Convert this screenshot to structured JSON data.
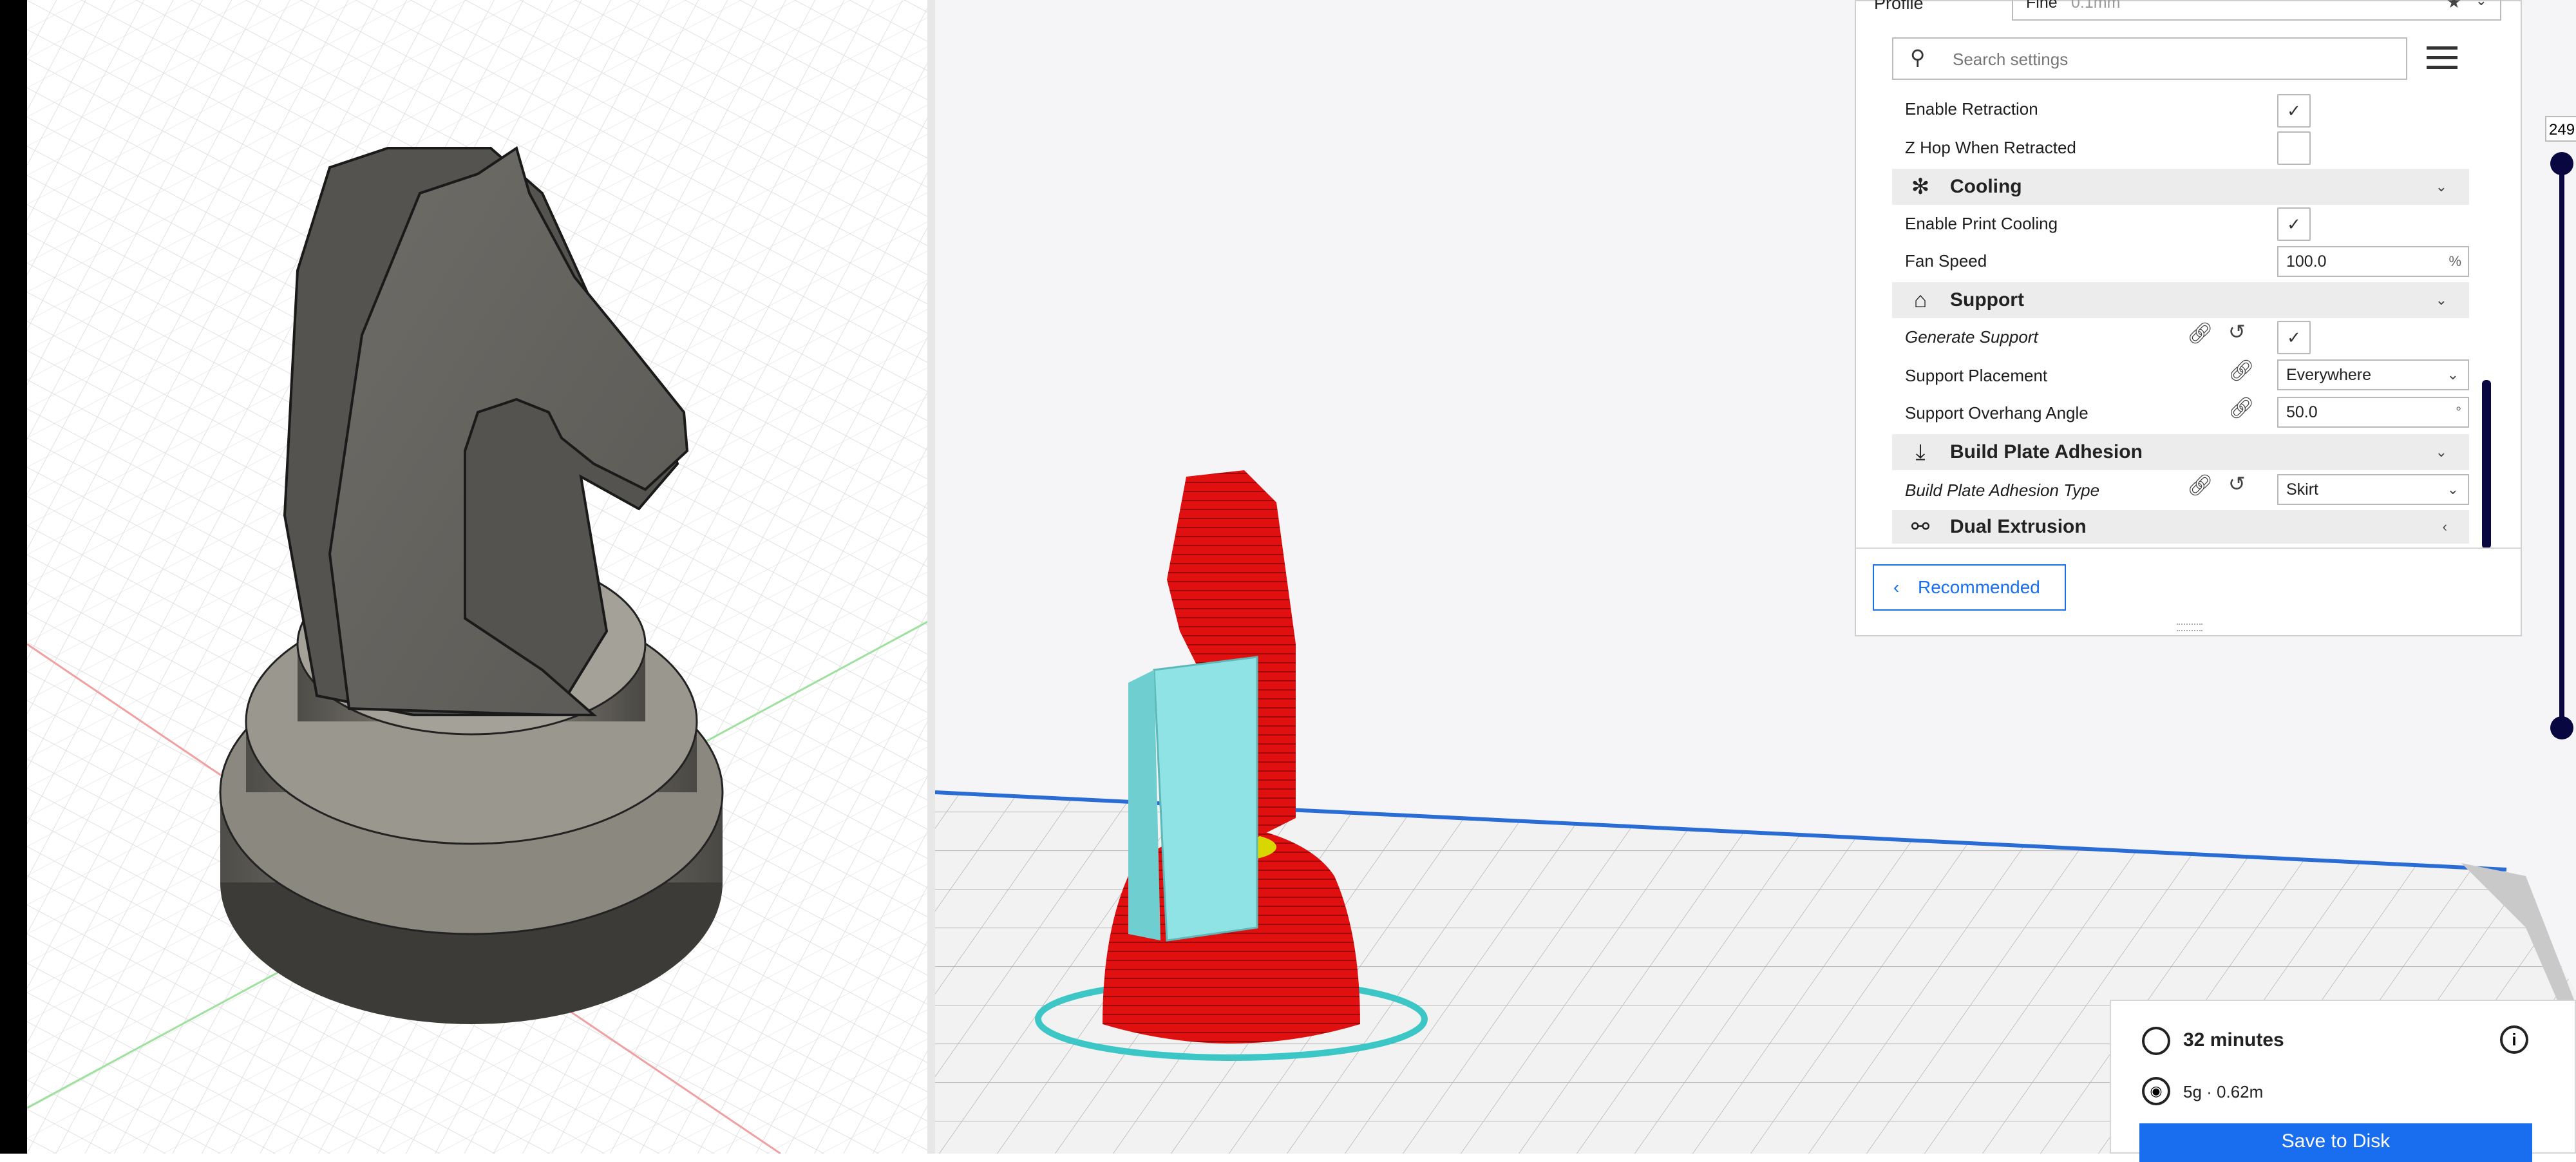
{
  "settings": {
    "profile_label": "Profile",
    "profile_value": "Fine",
    "profile_sub": "0.1mm",
    "search_placeholder": "Search settings",
    "rows": {
      "enable_retraction": "Enable Retraction",
      "z_hop": "Z Hop When Retracted",
      "enable_print_cooling": "Enable Print Cooling",
      "fan_speed": "Fan Speed",
      "fan_speed_value": "100.0",
      "fan_speed_unit": "%",
      "generate_support": "Generate Support",
      "support_placement": "Support Placement",
      "support_placement_value": "Everywhere",
      "support_overhang_angle": "Support Overhang Angle",
      "support_overhang_value": "50.0",
      "support_overhang_unit": "°",
      "adhesion_type": "Build Plate Adhesion Type",
      "adhesion_type_value": "Skirt"
    },
    "categories": {
      "cooling": "Cooling",
      "support": "Support",
      "build_plate_adhesion": "Build Plate Adhesion",
      "dual_extrusion": "Dual Extrusion"
    },
    "recommended_button": "Recommended"
  },
  "layer_slider": {
    "top_value": "249"
  },
  "print_info": {
    "time": "32 minutes",
    "material": "5g · 0.62m",
    "save_button": "Save to Disk"
  },
  "colors": {
    "accent": "#196ef0",
    "slider": "#08073f",
    "model_red": "#e01010",
    "support_cyan": "#8fe3e4"
  }
}
